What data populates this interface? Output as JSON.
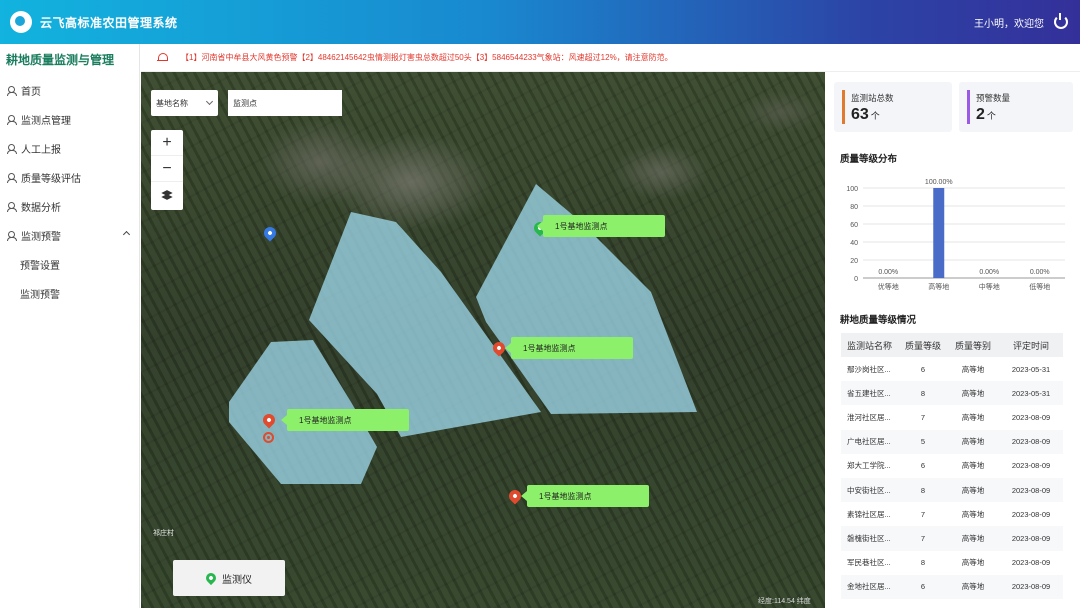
{
  "header": {
    "title": "云飞高标准农田管理系统",
    "user_greeting": "王小明，欢迎您"
  },
  "sidebar": {
    "title": "耕地质量监测与管理",
    "items": [
      {
        "label": "首页"
      },
      {
        "label": "监测点管理"
      },
      {
        "label": "人工上报"
      },
      {
        "label": "质量等级评估"
      },
      {
        "label": "数据分析"
      },
      {
        "label": "监测预警"
      }
    ],
    "subitems": [
      {
        "label": "预警设置"
      },
      {
        "label": "监测预警"
      }
    ]
  },
  "alert": {
    "text": "【1】河南省中牟县大风黄色预警【2】48462145642虫情测报灯害虫总数超过50头【3】5846544233气象站：风速超过12%，请注意防范。"
  },
  "map": {
    "base_select": "基地名称",
    "point_input_value": "监测点",
    "zoom_in": "+",
    "zoom_out": "−",
    "callouts": [
      "1号基地监测点",
      "1号基地监测点",
      "1号基地监测点",
      "1号基地监测点"
    ],
    "village_label": "祁庄村",
    "device_button": "监测仪",
    "coordinate": "经度:114.54    纬度"
  },
  "stats": [
    {
      "label": "监测站总数",
      "value": "63",
      "unit": "个",
      "color": "#e07a2e"
    },
    {
      "label": "预警数量",
      "value": "2",
      "unit": "个",
      "color": "#9b59e8"
    }
  ],
  "chart_title": "质量等级分布",
  "chart_data": {
    "type": "bar",
    "categories": [
      "优等地",
      "高等地",
      "中等地",
      "低等地"
    ],
    "values": [
      0,
      100,
      0,
      0
    ],
    "data_labels": [
      "0.00%",
      "100.00%",
      "0.00%",
      "0.00%"
    ],
    "yticks": [
      0,
      20,
      40,
      60,
      80,
      100
    ],
    "ylim": [
      0,
      100
    ],
    "bar_color": "#4a6cc8"
  },
  "table": {
    "title": "耕地质量等级情况",
    "headers": [
      "监测站名称",
      "质量等级",
      "质量等别",
      "评定时间"
    ],
    "rows": [
      [
        "鄢沙岗社区...",
        "6",
        "高等地",
        "2023-05-31"
      ],
      [
        "省五建社区...",
        "8",
        "高等地",
        "2023-05-31"
      ],
      [
        "淮河社区居...",
        "7",
        "高等地",
        "2023-08-09"
      ],
      [
        "广电社区居...",
        "5",
        "高等地",
        "2023-08-09"
      ],
      [
        "郑大工学院...",
        "6",
        "高等地",
        "2023-08-09"
      ],
      [
        "中安街社区...",
        "8",
        "高等地",
        "2023-08-09"
      ],
      [
        "素锦社区居...",
        "7",
        "高等地",
        "2023-08-09"
      ],
      [
        "磐槐街社区...",
        "7",
        "高等地",
        "2023-08-09"
      ],
      [
        "军民巷社区...",
        "8",
        "高等地",
        "2023-08-09"
      ],
      [
        "金地社区居...",
        "6",
        "高等地",
        "2023-08-09"
      ]
    ]
  }
}
